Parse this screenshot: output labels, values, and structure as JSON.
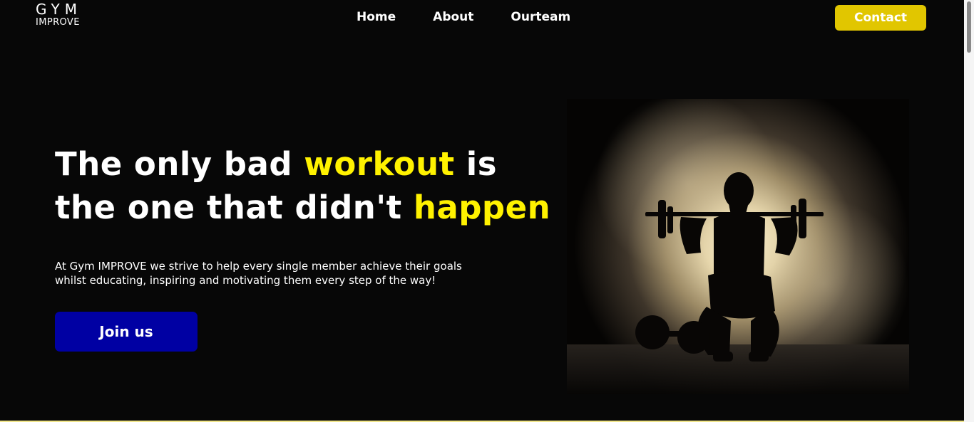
{
  "logo": {
    "top": "GYM",
    "bottom": "IMPROVE"
  },
  "nav": {
    "items": [
      {
        "label": "Home"
      },
      {
        "label": "About"
      },
      {
        "label": "Ourteam"
      }
    ],
    "contact_label": "Contact"
  },
  "hero": {
    "headline": {
      "part1": "The only bad ",
      "highlight1": "workout",
      "part2": " is",
      "part3": "the one that didn't ",
      "highlight2": "happen"
    },
    "description_line1": "At Gym IMPROVE we strive to help every single member achieve their goals",
    "description_line2": "whilst educating, inspiring and motivating them every step of the way!",
    "cta_label": "Join us"
  },
  "colors": {
    "background": "#070707",
    "highlight": "#fff200",
    "contact_button": "#e1c600",
    "join_button": "#0000a3"
  },
  "image": {
    "subject": "woman-squatting-with-barbell-silhouette"
  }
}
